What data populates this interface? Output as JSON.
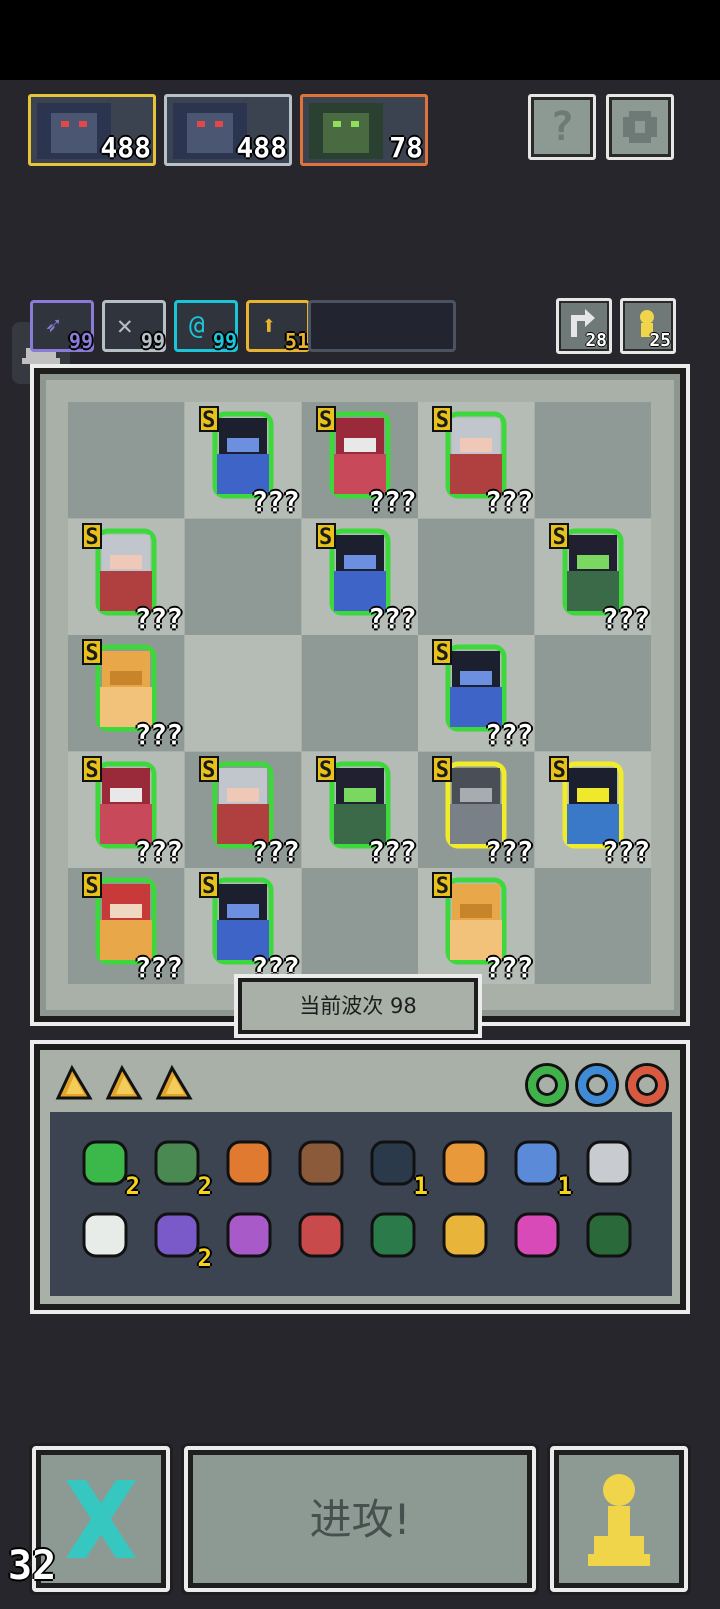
{
  "enemies": [
    {
      "count": "488",
      "border": "#e6c43a"
    },
    {
      "count": "488",
      "border": "#b8c0c8"
    },
    {
      "count": "78",
      "border": "#e0723a"
    }
  ],
  "top_buttons": {
    "help_label": "?",
    "settings_icon": "gear-icon"
  },
  "synergies": [
    {
      "count": "99",
      "icon": "wing-icon",
      "color": "#8a7bd8"
    },
    {
      "count": "99",
      "icon": "bird-icon",
      "color": "#b7bfc6"
    },
    {
      "count": "99",
      "icon": "swirl-icon",
      "color": "#1cc4d8"
    },
    {
      "count": "51",
      "icon": "arrow-up-icon",
      "color": "#e8b430"
    }
  ],
  "right_counters": [
    {
      "count": "28",
      "icon": "refresh-icon"
    },
    {
      "count": "25",
      "icon": "pawn-icon"
    }
  ],
  "board": {
    "rows": [
      [
        null,
        {
          "type": "hood",
          "label": "???"
        },
        {
          "type": "hat",
          "label": "???"
        },
        {
          "type": "silver",
          "label": "???"
        },
        null
      ],
      [
        {
          "type": "silver",
          "label": "???"
        },
        null,
        {
          "type": "hood",
          "label": "???"
        },
        null,
        {
          "type": "dark",
          "label": "???"
        }
      ],
      [
        {
          "type": "gold",
          "label": "???"
        },
        null,
        null,
        {
          "type": "hood",
          "label": "???"
        },
        null
      ],
      [
        {
          "type": "hat",
          "label": "???"
        },
        {
          "type": "silver",
          "label": "???"
        },
        {
          "type": "dark",
          "label": "???"
        },
        {
          "type": "knight",
          "label": "???"
        },
        {
          "type": "mage",
          "label": "???"
        }
      ],
      [
        {
          "type": "beard",
          "label": "???"
        },
        {
          "type": "hood",
          "label": "???"
        },
        null,
        {
          "type": "gold",
          "label": "???"
        },
        null
      ]
    ],
    "rank": "S"
  },
  "wave_label": "当前波次 98",
  "rings": [
    "#3fb24a",
    "#3f8bd8",
    "#d8593f"
  ],
  "items_row1": [
    {
      "name": "emerald-icon",
      "count": "2"
    },
    {
      "name": "helmet-icon",
      "count": "2"
    },
    {
      "name": "shield-icon",
      "count": ""
    },
    {
      "name": "slingshot-icon",
      "count": ""
    },
    {
      "name": "orb-icon",
      "count": "1"
    },
    {
      "name": "boomerang-icon",
      "count": ""
    },
    {
      "name": "crossbow-icon",
      "count": "1"
    },
    {
      "name": "sickle-icon",
      "count": ""
    }
  ],
  "items_row2": [
    {
      "name": "moon-icon",
      "count": ""
    },
    {
      "name": "hourglass-icon",
      "count": "2"
    },
    {
      "name": "staff-icon",
      "count": ""
    },
    {
      "name": "arrow-icon",
      "count": ""
    },
    {
      "name": "jade-tile-icon",
      "count": ""
    },
    {
      "name": "chalice-icon",
      "count": ""
    },
    {
      "name": "pink-arrow-icon",
      "count": ""
    },
    {
      "name": "rune-tile-icon",
      "count": ""
    }
  ],
  "attack_label": "进攻!",
  "fps": "32"
}
